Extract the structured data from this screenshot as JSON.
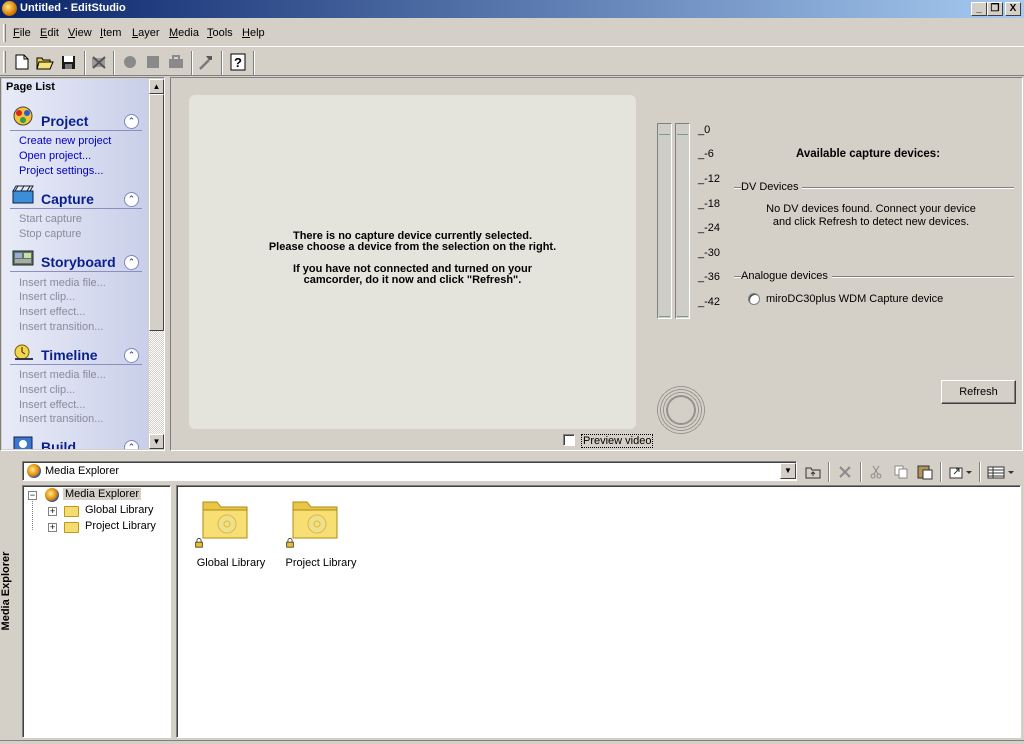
{
  "window": {
    "title": "Untitled - EditStudio",
    "minimize": "_",
    "restore": "❐",
    "close": "X"
  },
  "menu": [
    {
      "label": "File",
      "accel": "F",
      "rest": "ile"
    },
    {
      "label": "Edit",
      "accel": "E",
      "rest": "dit"
    },
    {
      "label": "View",
      "accel": "V",
      "rest": "iew"
    },
    {
      "label": "Item",
      "accel": "I",
      "rest": "tem"
    },
    {
      "label": "Layer",
      "accel": "L",
      "rest": "ayer"
    },
    {
      "label": "Media",
      "accel": "M",
      "rest": "edia"
    },
    {
      "label": "Tools",
      "accel": "T",
      "rest": "ools"
    },
    {
      "label": "Help",
      "accel": "H",
      "rest": "elp"
    }
  ],
  "toolbar": {
    "icons": [
      "new-document-icon",
      "open-folder-icon",
      "save-icon",
      "delete-clip-icon",
      "record-icon",
      "stop-icon",
      "toolbox-icon",
      "hammer-icon",
      "help-icon"
    ]
  },
  "page_list": {
    "title": "Page List",
    "sections": [
      {
        "title": "Project",
        "links": [
          {
            "label": "Create new project",
            "enabled": true
          },
          {
            "label": "Open project...",
            "enabled": true
          },
          {
            "label": "Project settings...",
            "enabled": true
          }
        ]
      },
      {
        "title": "Capture",
        "links": [
          {
            "label": "Start capture",
            "enabled": false
          },
          {
            "label": "Stop capture",
            "enabled": false
          }
        ]
      },
      {
        "title": "Storyboard",
        "links": [
          {
            "label": "Insert media file...",
            "enabled": false
          },
          {
            "label": "Insert clip...",
            "enabled": false
          },
          {
            "label": "Insert effect...",
            "enabled": false
          },
          {
            "label": "Insert transition...",
            "enabled": false
          }
        ]
      },
      {
        "title": "Timeline",
        "links": [
          {
            "label": "Insert media file...",
            "enabled": false
          },
          {
            "label": "Insert clip...",
            "enabled": false
          },
          {
            "label": "Insert effect...",
            "enabled": false
          },
          {
            "label": "Insert transition...",
            "enabled": false
          }
        ]
      },
      {
        "title": "Build",
        "links": []
      }
    ]
  },
  "capture": {
    "message_line1": "There is no capture device currently selected.",
    "message_line2": "Please choose a device from the selection on the right.",
    "message_line3": "If you have not connected and turned on your",
    "message_line4": "camcorder, do it now and click \"Refresh\".",
    "db_scale": [
      "0",
      "-6",
      "-12",
      "-18",
      "-24",
      "-30",
      "-36",
      "-42"
    ],
    "preview_video_label": "Preview video",
    "preview_video_checked": false,
    "available_title": "Available capture devices:",
    "dv_group": "DV Devices",
    "dv_message_line1": "No DV devices found. Connect your device",
    "dv_message_line2": "and click Refresh to detect new devices.",
    "analogue_group": "Analogue devices",
    "analogue_device": "miroDC30plus WDM Capture device",
    "refresh_label": "Refresh"
  },
  "media_explorer": {
    "vertical_tab": "Media Explorer",
    "location": "Media Explorer",
    "toolbar_icons": [
      "up-folder-icon",
      "delete-icon",
      "cut-icon",
      "copy-icon",
      "paste-icon",
      "view-mode-icon",
      "details-view-icon"
    ],
    "tree": {
      "root": "Media Explorer",
      "root_expander": "−",
      "children": [
        {
          "label": "Global Library",
          "expander": "+"
        },
        {
          "label": "Project Library",
          "expander": "+"
        }
      ]
    },
    "items": [
      {
        "label": "Global Library"
      },
      {
        "label": "Project Library"
      }
    ]
  }
}
